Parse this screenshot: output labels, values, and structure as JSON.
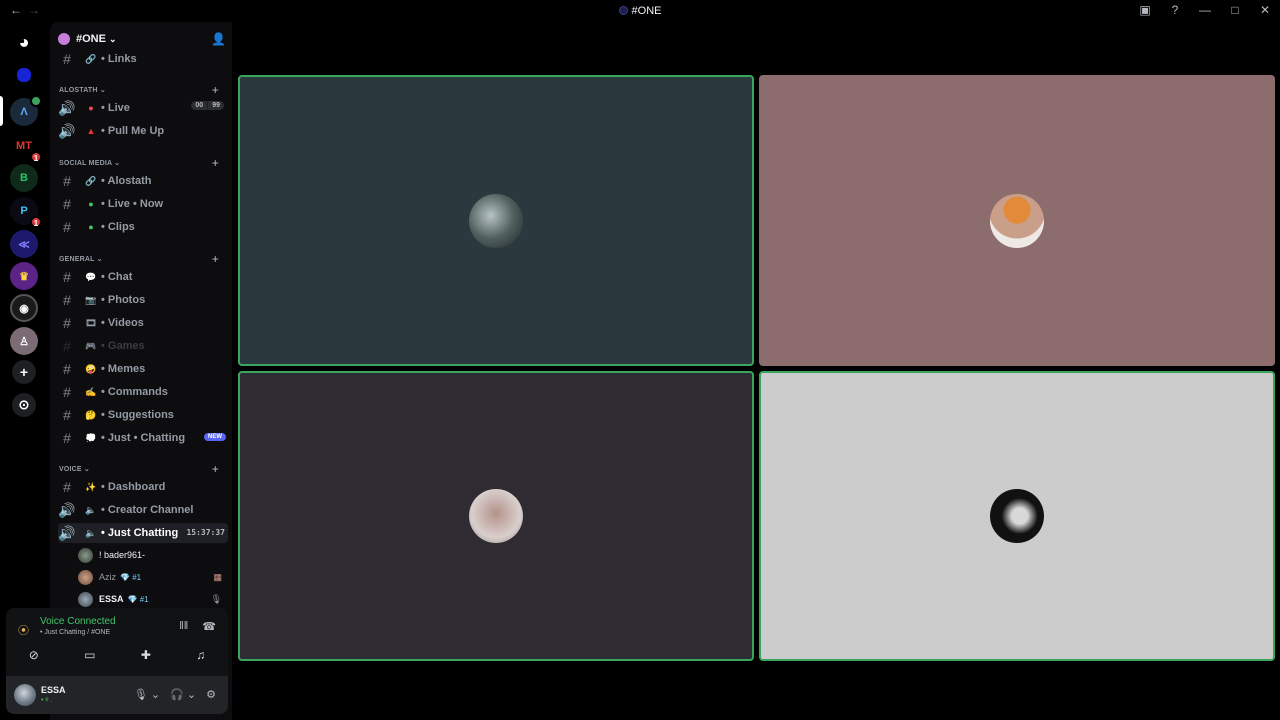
{
  "window": {
    "title": "#ONE",
    "back_glyph": "←",
    "forward_glyph": "→",
    "inbox_glyph": "▣",
    "help_glyph": "?",
    "minimize_glyph": "—",
    "maximize_glyph": "□",
    "close_glyph": "✕"
  },
  "servers": {
    "home_glyph": "◕",
    "add_glyph": "+",
    "discover_glyph": "⊙",
    "badge_1": "1",
    "badge_2": "1",
    "badge_3": "1"
  },
  "server_header": {
    "name": "#ONE",
    "chevron": "⌄",
    "invite_glyph": "👤"
  },
  "sidebar": {
    "channel_links": "• Links",
    "cat_alostath": "ALOSTATH ⌄",
    "ch_live": "• Live",
    "live_count_a": "00",
    "live_count_b": "99",
    "ch_pull": "• Pull Me Up",
    "cat_social": "SOCIAL MEDIA ⌄",
    "ch_alostath": "• Alostath",
    "ch_live_now": "• Live • Now",
    "ch_clips": "• Clips",
    "cat_general": "GENERAL ⌄",
    "ch_chat": "• Chat",
    "ch_photos": "• Photos",
    "ch_videos": "• Videos",
    "ch_games": "• Games",
    "ch_memes": "• Memes",
    "ch_commands": "• Commands",
    "ch_suggestions": "• Suggestions",
    "ch_just_chatting_text": "• Just • Chatting",
    "new_badge": "NEW",
    "cat_voice": "VOICE ⌄",
    "ch_dashboard": "• Dashboard",
    "ch_creator": "•  Creator Channel",
    "ch_just_chatting_voice": "• Just Chatting",
    "voice_timer": "15:37:37",
    "plus": "+"
  },
  "voice_users": [
    {
      "name": "! bader961-",
      "tag": "",
      "end": ""
    },
    {
      "name": "Aziz",
      "tag": "💎 #1",
      "end": "▦"
    },
    {
      "name": "ESSA",
      "tag": "💎 #1",
      "end": "🎙"
    }
  ],
  "voice_panel": {
    "title": "Voice Connected",
    "subtitle": "• Just Chatting / #ONE",
    "signal_glyph": "⦿",
    "noise_glyph": "‖‖",
    "disconnect_glyph": "☎",
    "video_glyph": "⊘",
    "screen_glyph": "▭",
    "activity_glyph": "✚",
    "soundboard_glyph": "♫"
  },
  "user_panel": {
    "name": "ESSA",
    "status": "• ᵠ .",
    "mic_glyph": "🎙 ⌄",
    "headset_glyph": "🎧 ⌄",
    "settings_glyph": "⚙"
  },
  "colors": {
    "speaking_border": "#3ba55d",
    "tile1": "#29393e",
    "tile2": "#8c6c6c",
    "tile3": "#2e2b33",
    "tile4": "#cccccc"
  }
}
